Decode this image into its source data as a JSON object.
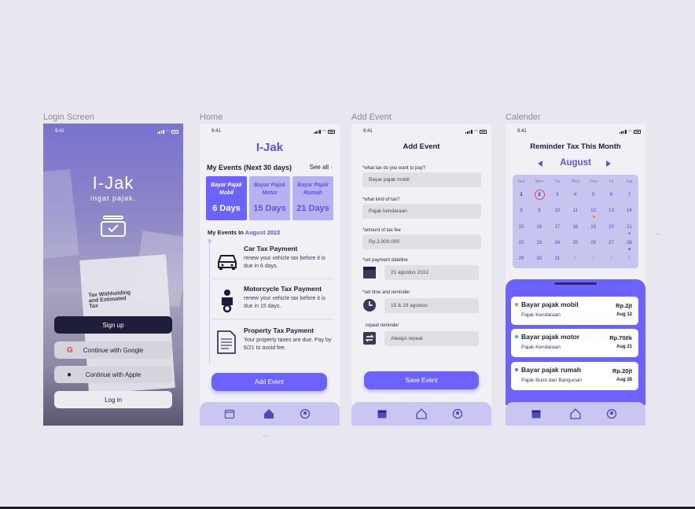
{
  "frames": [
    "Login Screen",
    "Home",
    "Add Event",
    "Calender"
  ],
  "status_time": "9:41",
  "login": {
    "title": "I-Jak",
    "subtitle": "ingat pajak.",
    "doc_text": "Tax Withholding and Estimated Tax",
    "doc_year": "2019",
    "signup": "Sign up",
    "google": "Continue with Google",
    "apple": "Continue with Apple",
    "login": "Log in"
  },
  "home": {
    "brand": "I-Jak",
    "my_events": "My Events (Next 30 days)",
    "see_all": "See all",
    "cards": [
      {
        "title1": "Bayar Pajak",
        "title2": "Mobil",
        "days": "6 Days"
      },
      {
        "title1": "Bayar Pajak",
        "title2": "Motor",
        "days": "15 Days"
      },
      {
        "title1": "Bayar Pajak",
        "title2": "Rumah",
        "days": "21 Days"
      }
    ],
    "events_in": "My Events In",
    "month": "August 2022",
    "events": [
      {
        "title": "Car Tax Payment",
        "desc": "renew your vehicle tax before it is due in 6 days."
      },
      {
        "title": "Motorcycle Tax Payment",
        "desc": "renew your vehicle tax before it is due in 15 days."
      },
      {
        "title": "Property Tax Payment",
        "desc": "Your property taxes are due. Pay by 6/21 to avoid fee."
      }
    ],
    "add_event": "Add Event"
  },
  "add": {
    "title": "Add Event",
    "q1": "*what tax do you want to pay?",
    "v1": "Bayar pajak mobil",
    "q2": "*what kind of tax?",
    "v2": "Pajak kendaraan",
    "q3": "*amount of tax fee",
    "v3": "Rp.2.000.000",
    "q4": "*set payment dateline",
    "v4": "21 agustus 2022",
    "q5": "*set  time and reminder",
    "v5": "15 & 19 agustus",
    "q6": "repeat reminder",
    "v6": "Always repeat",
    "save": "Save Event"
  },
  "calendar": {
    "title": "Reminder Tax This Month",
    "month": "August",
    "weekdays": [
      "Sun",
      "Mon",
      "Tue",
      "Wed",
      "Thur",
      "Fri",
      "Sat"
    ],
    "days": [
      [
        "1",
        "2",
        "3",
        "4",
        "5",
        "6",
        "7"
      ],
      [
        "8",
        "9",
        "10",
        "11",
        "12",
        "13",
        "14"
      ],
      [
        "15",
        "16",
        "17",
        "18",
        "19",
        "20",
        "21"
      ],
      [
        "22",
        "23",
        "24",
        "25",
        "26",
        "27",
        "28"
      ],
      [
        "29",
        "30",
        "31",
        "1",
        "2",
        "3",
        "4"
      ]
    ],
    "reminders": [
      {
        "title": "Bayar pajak mobil",
        "sub": "Pajak Kendaraan",
        "amount": "Rp.2jt",
        "date": "Aug 12",
        "color": "#ff7a30"
      },
      {
        "title": "Bayar pajak motor",
        "sub": "Pajak Kendaraan",
        "amount": "Rp.700k",
        "date": "Aug 21",
        "color": "#2ec27e"
      },
      {
        "title": "Bayar pajak rumah",
        "sub": "Pajak Bumi dan Bangunan",
        "amount": "Rp.20jt",
        "date": "Aug 28",
        "color": "#6c63ff"
      }
    ]
  },
  "ellipsis": "..."
}
